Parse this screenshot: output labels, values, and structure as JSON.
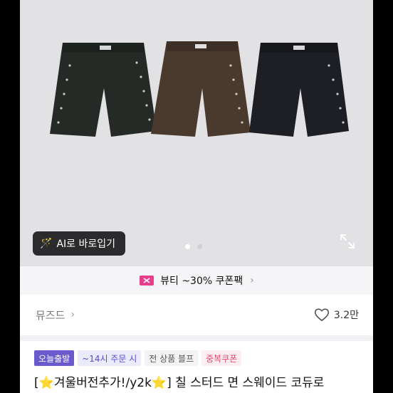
{
  "product_image": {
    "alt_colors": [
      "#262a26",
      "#4a3a2e",
      "#1d1f24"
    ]
  },
  "ai_button": {
    "label": "AI로 바로입기"
  },
  "carousel": {
    "count": 2,
    "active": 1
  },
  "banner": {
    "text": "뷰티 ~30% 쿠폰팩",
    "chevron": "›"
  },
  "brand": {
    "name": "뮤즈드",
    "chevron": "›"
  },
  "likes": {
    "count": "3.2만"
  },
  "tags": [
    "오늘출발",
    "~14시 주문 시",
    "전 상품 블프",
    "중복쿠폰"
  ],
  "title": {
    "prefix": "[",
    "star1": "⭐",
    "part1": "겨울버전추가!/y2k",
    "star2": "⭐",
    "part2": "] 칠 스터드 면 스웨이드 코듀로"
  }
}
